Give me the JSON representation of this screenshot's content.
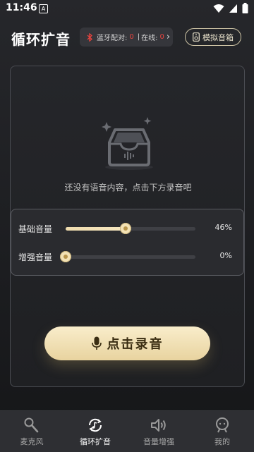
{
  "status": {
    "time": "11:46",
    "indicator": "A"
  },
  "header": {
    "title": "循环扩音",
    "bluetooth": {
      "label": "蓝牙配对:",
      "paired": "0",
      "online_label": "在线:",
      "online": "0"
    },
    "speaker_button": "模拟音箱"
  },
  "empty": {
    "text": "还没有语音内容，点击下方录音吧"
  },
  "volume": {
    "base": {
      "label": "基础音量",
      "value": "46%",
      "level": 0.46
    },
    "boost": {
      "label": "增强音量",
      "value": "0%",
      "level": 0.0
    }
  },
  "record_button": "点击录音",
  "nav": [
    {
      "label": "麦克风",
      "icon": "microphone-icon"
    },
    {
      "label": "循环扩音",
      "icon": "loop-music-icon",
      "active": true
    },
    {
      "label": "音量增强",
      "icon": "volume-icon"
    },
    {
      "label": "我的",
      "icon": "profile-icon"
    }
  ],
  "colors": {
    "accent": "#f3e2b5",
    "alert": "#e8433e",
    "background": "#1f2023"
  }
}
